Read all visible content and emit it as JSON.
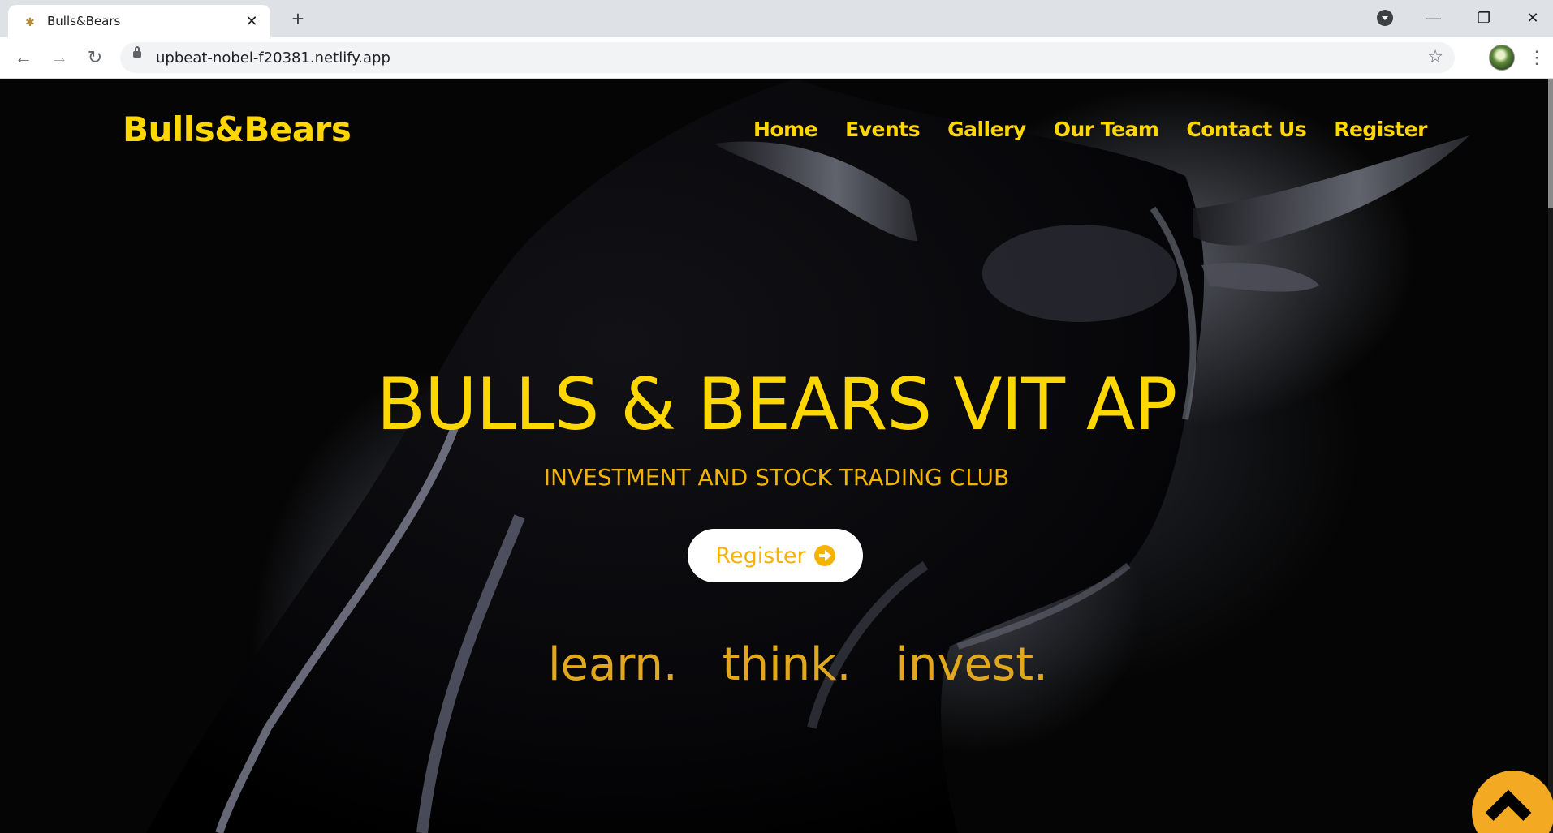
{
  "browser": {
    "tab_title": "Bulls&Bears",
    "url": "upbeat-nobel-f20381.netlify.app",
    "icons": [
      "favicon-icon",
      "close-tab-icon",
      "new-tab-icon",
      "profile-dropdown-icon",
      "minimize-icon",
      "maximize-icon",
      "close-window-icon",
      "back-icon",
      "forward-icon",
      "reload-icon",
      "lock-icon",
      "bookmark-star-icon",
      "avatar",
      "menu-dots-icon"
    ]
  },
  "site": {
    "logo": "Bulls&Bears",
    "nav": [
      "Home",
      "Events",
      "Gallery",
      "Our Team",
      "Contact Us",
      "Register"
    ],
    "hero_title": "BULLS & BEARS VIT AP",
    "hero_subtitle": "INVESTMENT AND STOCK TRADING CLUB",
    "cta_label": "Register",
    "tagline": [
      "learn.",
      "think.",
      "invest."
    ]
  },
  "colors": {
    "brand_yellow": "#ffd700",
    "accent_orange": "#f4b300",
    "background": "#000000"
  }
}
